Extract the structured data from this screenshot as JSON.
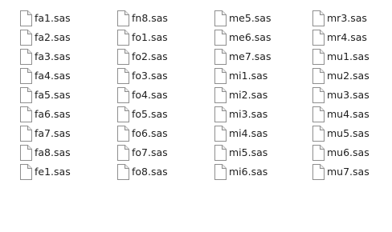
{
  "icons": {
    "file": "blank-document-icon"
  },
  "columns": [
    {
      "files": [
        {
          "name": "fa1.sas"
        },
        {
          "name": "fa2.sas"
        },
        {
          "name": "fa3.sas"
        },
        {
          "name": "fa4.sas"
        },
        {
          "name": "fa5.sas"
        },
        {
          "name": "fa6.sas"
        },
        {
          "name": "fa7.sas"
        },
        {
          "name": "fa8.sas"
        },
        {
          "name": "fe1.sas"
        }
      ]
    },
    {
      "files": [
        {
          "name": "fn8.sas"
        },
        {
          "name": "fo1.sas"
        },
        {
          "name": "fo2.sas"
        },
        {
          "name": "fo3.sas"
        },
        {
          "name": "fo4.sas"
        },
        {
          "name": "fo5.sas"
        },
        {
          "name": "fo6.sas"
        },
        {
          "name": "fo7.sas"
        },
        {
          "name": "fo8.sas"
        }
      ]
    },
    {
      "files": [
        {
          "name": "me5.sas"
        },
        {
          "name": "me6.sas"
        },
        {
          "name": "me7.sas"
        },
        {
          "name": "mi1.sas"
        },
        {
          "name": "mi2.sas"
        },
        {
          "name": "mi3.sas"
        },
        {
          "name": "mi4.sas"
        },
        {
          "name": "mi5.sas"
        },
        {
          "name": "mi6.sas"
        }
      ]
    },
    {
      "files": [
        {
          "name": "mr3.sas"
        },
        {
          "name": "mr4.sas"
        },
        {
          "name": "mu1.sas"
        },
        {
          "name": "mu2.sas"
        },
        {
          "name": "mu3.sas"
        },
        {
          "name": "mu4.sas"
        },
        {
          "name": "mu5.sas"
        },
        {
          "name": "mu6.sas"
        },
        {
          "name": "mu7.sas"
        }
      ]
    }
  ]
}
